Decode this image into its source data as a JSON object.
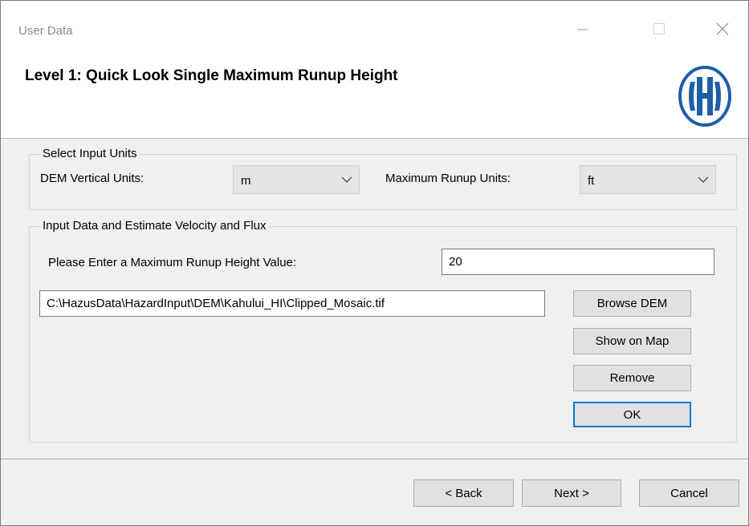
{
  "window": {
    "title": "User Data"
  },
  "header": {
    "title": "Level 1: Quick Look Single Maximum Runup Height",
    "logo": "hazus-h-logo"
  },
  "units_group": {
    "legend": "Select Input Units",
    "dem_label": "DEM Vertical Units:",
    "dem_value": "m",
    "runup_label": "Maximum Runup Units:",
    "runup_value": "ft"
  },
  "input_group": {
    "legend": "Input Data and Estimate Velocity and Flux",
    "runup_height_label": "Please Enter a Maximum Runup Height Value:",
    "runup_height_value": "20",
    "dem_path": "C:\\HazusData\\HazardInput\\DEM\\Kahului_HI\\Clipped_Mosaic.tif",
    "browse_label": "Browse DEM",
    "show_map_label": "Show on Map",
    "remove_label": "Remove",
    "ok_label": "OK"
  },
  "footer": {
    "back_label": "< Back",
    "next_label": "Next >",
    "cancel_label": "Cancel"
  },
  "colors": {
    "accent": "#0078d7",
    "logo_blue": "#1d5ea8"
  }
}
